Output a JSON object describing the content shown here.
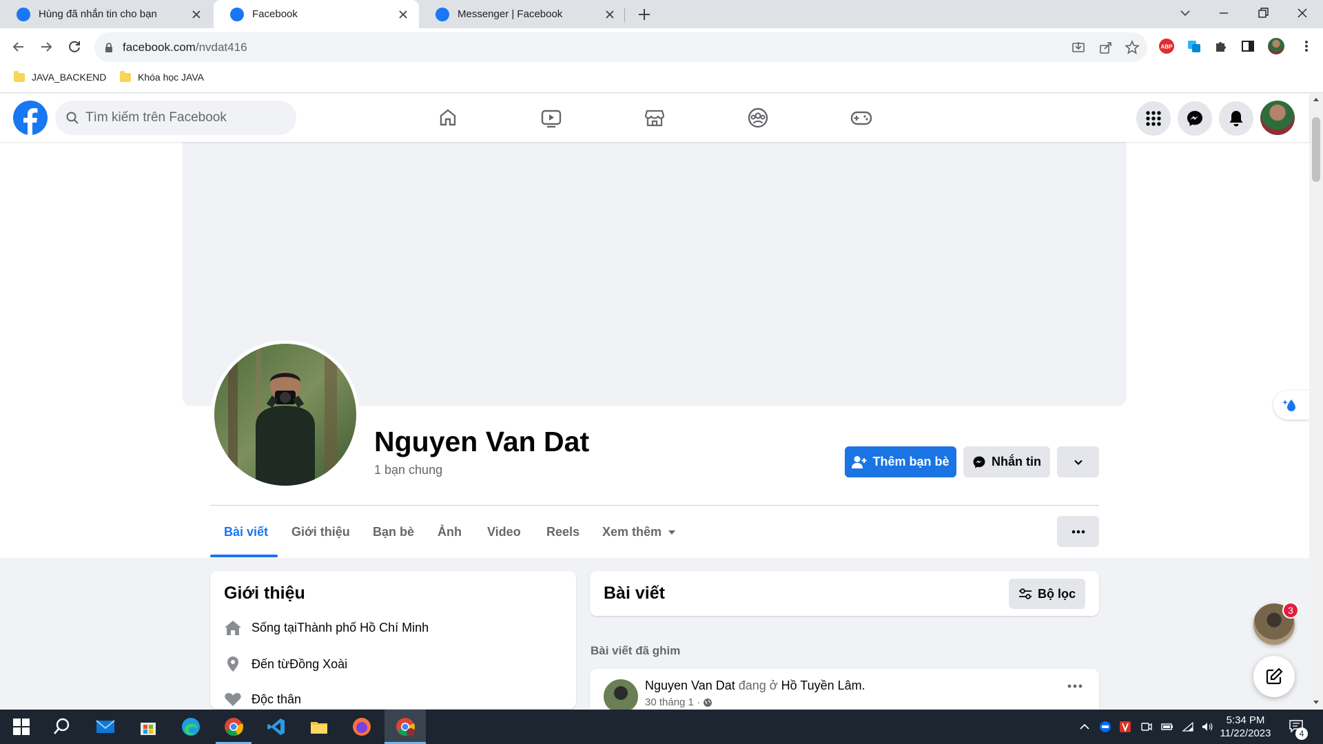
{
  "browser": {
    "tabs": [
      {
        "title": "Hùng đã nhắn tin cho bạn",
        "active": false
      },
      {
        "title": "Facebook",
        "active": true
      },
      {
        "title": "Messenger | Facebook",
        "active": false
      }
    ],
    "url_host": "facebook.com",
    "url_path": "/nvdat416",
    "bookmarks": [
      "JAVA_BACKEND",
      "Khóa học JAVA"
    ],
    "extensions": [
      "download-icon",
      "share-icon",
      "star-icon",
      "adblock-icon",
      "translate-icon",
      "puzzle-icon",
      "sidepanel-icon",
      "profile-avatar"
    ]
  },
  "fb": {
    "search_placeholder": "Tìm kiếm trên Facebook",
    "nav": [
      "home-icon",
      "watch-icon",
      "marketplace-icon",
      "groups-icon",
      "gaming-icon"
    ],
    "accent": "#1877f2"
  },
  "profile": {
    "name": "Nguyen Van Dat",
    "mutual": "1 bạn chung",
    "add_friend": "Thêm bạn bè",
    "message": "Nhắn tin",
    "tabs": [
      "Bài viết",
      "Giới thiệu",
      "Bạn bè",
      "Ảnh",
      "Video",
      "Reels",
      "Xem thêm"
    ]
  },
  "intro": {
    "title": "Giới thiệu",
    "lives_prefix": "Sống tại ",
    "lives_place": "Thành phố Hồ Chí Minh",
    "from_prefix": "Đến từ ",
    "from_place": "Đồng Xoài",
    "relationship": "Độc thân"
  },
  "posts": {
    "title": "Bài viết",
    "filter": "Bộ lọc",
    "pinned": "Bài viết đã ghim",
    "post": {
      "author": "Nguyen Van Dat",
      "at_text": " đang ở ",
      "place": "Hồ Tuyền Lâm",
      "date": "30 tháng 1 · "
    }
  },
  "chat": {
    "badge": "3"
  },
  "taskbar": {
    "time": "5:34 PM",
    "date": "11/22/2023",
    "notif_count": "4"
  }
}
